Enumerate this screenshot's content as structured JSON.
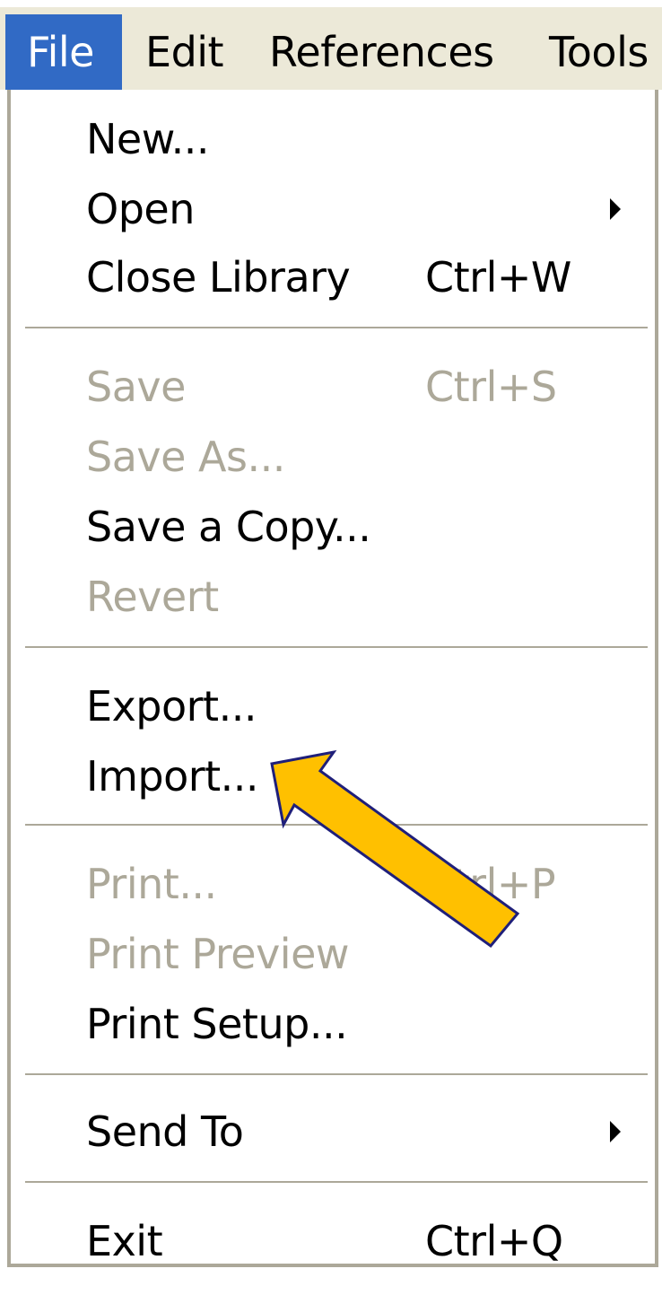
{
  "menubar": {
    "items": [
      {
        "label": "File",
        "active": true
      },
      {
        "label": "Edit",
        "active": false
      },
      {
        "label": "References",
        "active": false
      },
      {
        "label": "Tools",
        "active": false
      }
    ]
  },
  "file_menu": {
    "items": [
      {
        "label": "New...",
        "shortcut": "",
        "enabled": true,
        "submenu": false
      },
      {
        "label": "Open",
        "shortcut": "",
        "enabled": true,
        "submenu": true
      },
      {
        "label": "Close Library",
        "shortcut": "Ctrl+W",
        "enabled": true,
        "submenu": false
      },
      {
        "label": "Save",
        "shortcut": "Ctrl+S",
        "enabled": false,
        "submenu": false
      },
      {
        "label": "Save As...",
        "shortcut": "",
        "enabled": false,
        "submenu": false
      },
      {
        "label": "Save a Copy...",
        "shortcut": "",
        "enabled": true,
        "submenu": false
      },
      {
        "label": "Revert",
        "shortcut": "",
        "enabled": false,
        "submenu": false
      },
      {
        "label": "Export...",
        "shortcut": "",
        "enabled": true,
        "submenu": false
      },
      {
        "label": "Import...",
        "shortcut": "",
        "enabled": true,
        "submenu": false
      },
      {
        "label": "Print...",
        "shortcut": "Ctrl+P",
        "enabled": false,
        "submenu": false
      },
      {
        "label": "Print Preview",
        "shortcut": "",
        "enabled": false,
        "submenu": false
      },
      {
        "label": "Print Setup...",
        "shortcut": "",
        "enabled": true,
        "submenu": false
      },
      {
        "label": "Send To",
        "shortcut": "",
        "enabled": true,
        "submenu": true
      },
      {
        "label": "Exit",
        "shortcut": "Ctrl+Q",
        "enabled": true,
        "submenu": false
      }
    ]
  },
  "annotation": {
    "icon": "callout-arrow-icon",
    "fill_color": "#ffc000",
    "stroke_color": "#1f1f7a",
    "points_to": "Import..."
  },
  "colors": {
    "menubar_bg": "#ece9d8",
    "highlight": "#316ac5",
    "disabled_text": "#aca899",
    "separator": "#aca899"
  }
}
